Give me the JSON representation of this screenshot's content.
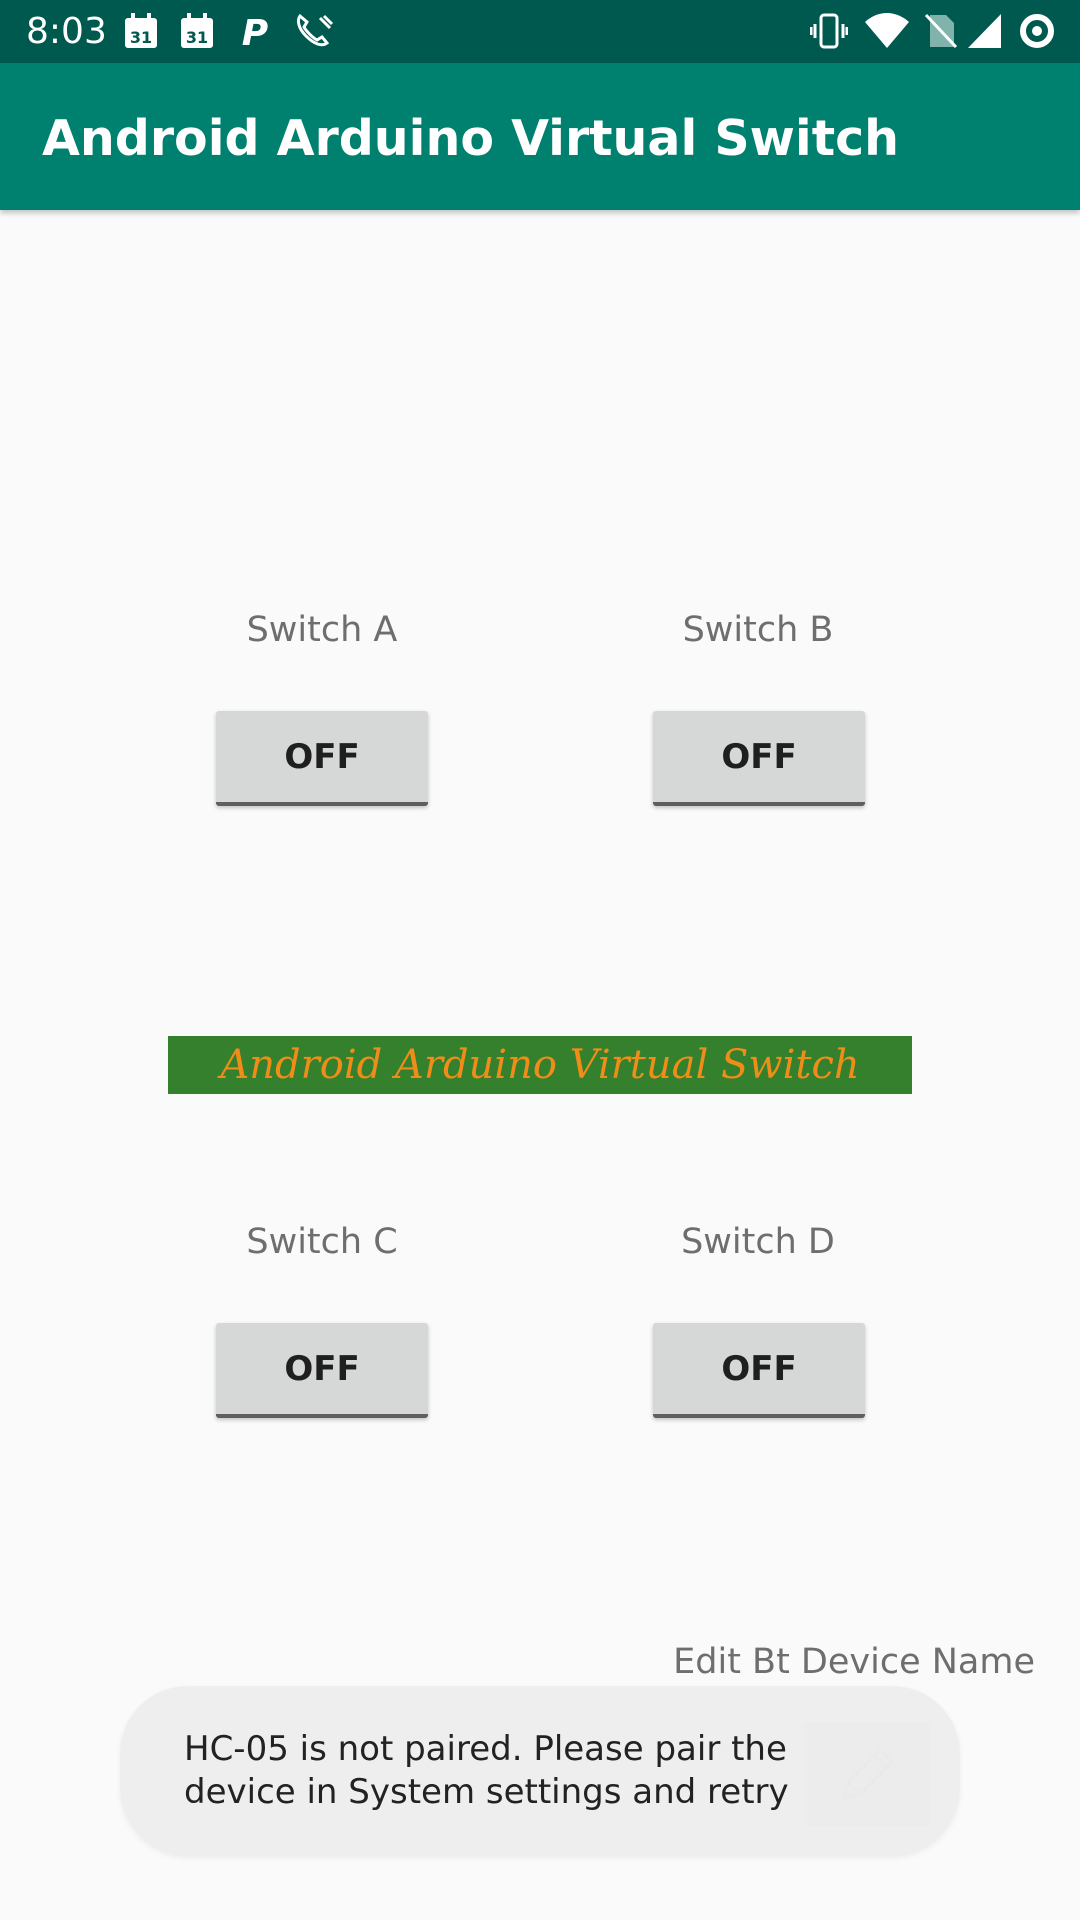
{
  "status_bar": {
    "time": "8:03",
    "icons": [
      "calendar-icon",
      "calendar-icon",
      "parking-icon",
      "phone-call-icon",
      "vibrate-icon",
      "wifi-icon",
      "no-sim-icon",
      "signal-icon",
      "sync-icon"
    ],
    "calendar_day": "31",
    "parking_letter": "P"
  },
  "app_bar": {
    "title": "Android Arduino Virtual Switch",
    "color": "#00806f"
  },
  "switches": [
    {
      "label": "Switch A",
      "state": "OFF"
    },
    {
      "label": "Switch B",
      "state": "OFF"
    },
    {
      "label": "Switch C",
      "state": "OFF"
    },
    {
      "label": "Switch D",
      "state": "OFF"
    }
  ],
  "banner": {
    "text": "Android Arduino Virtual Switch",
    "background": "#35802d",
    "text_color": "#f08d18"
  },
  "edit_device": {
    "label": "Edit Bt Device Name",
    "icon": "pencil-icon"
  },
  "toast": {
    "message": "HC-05 is not paired. Please pair the device in System settings and retry"
  }
}
